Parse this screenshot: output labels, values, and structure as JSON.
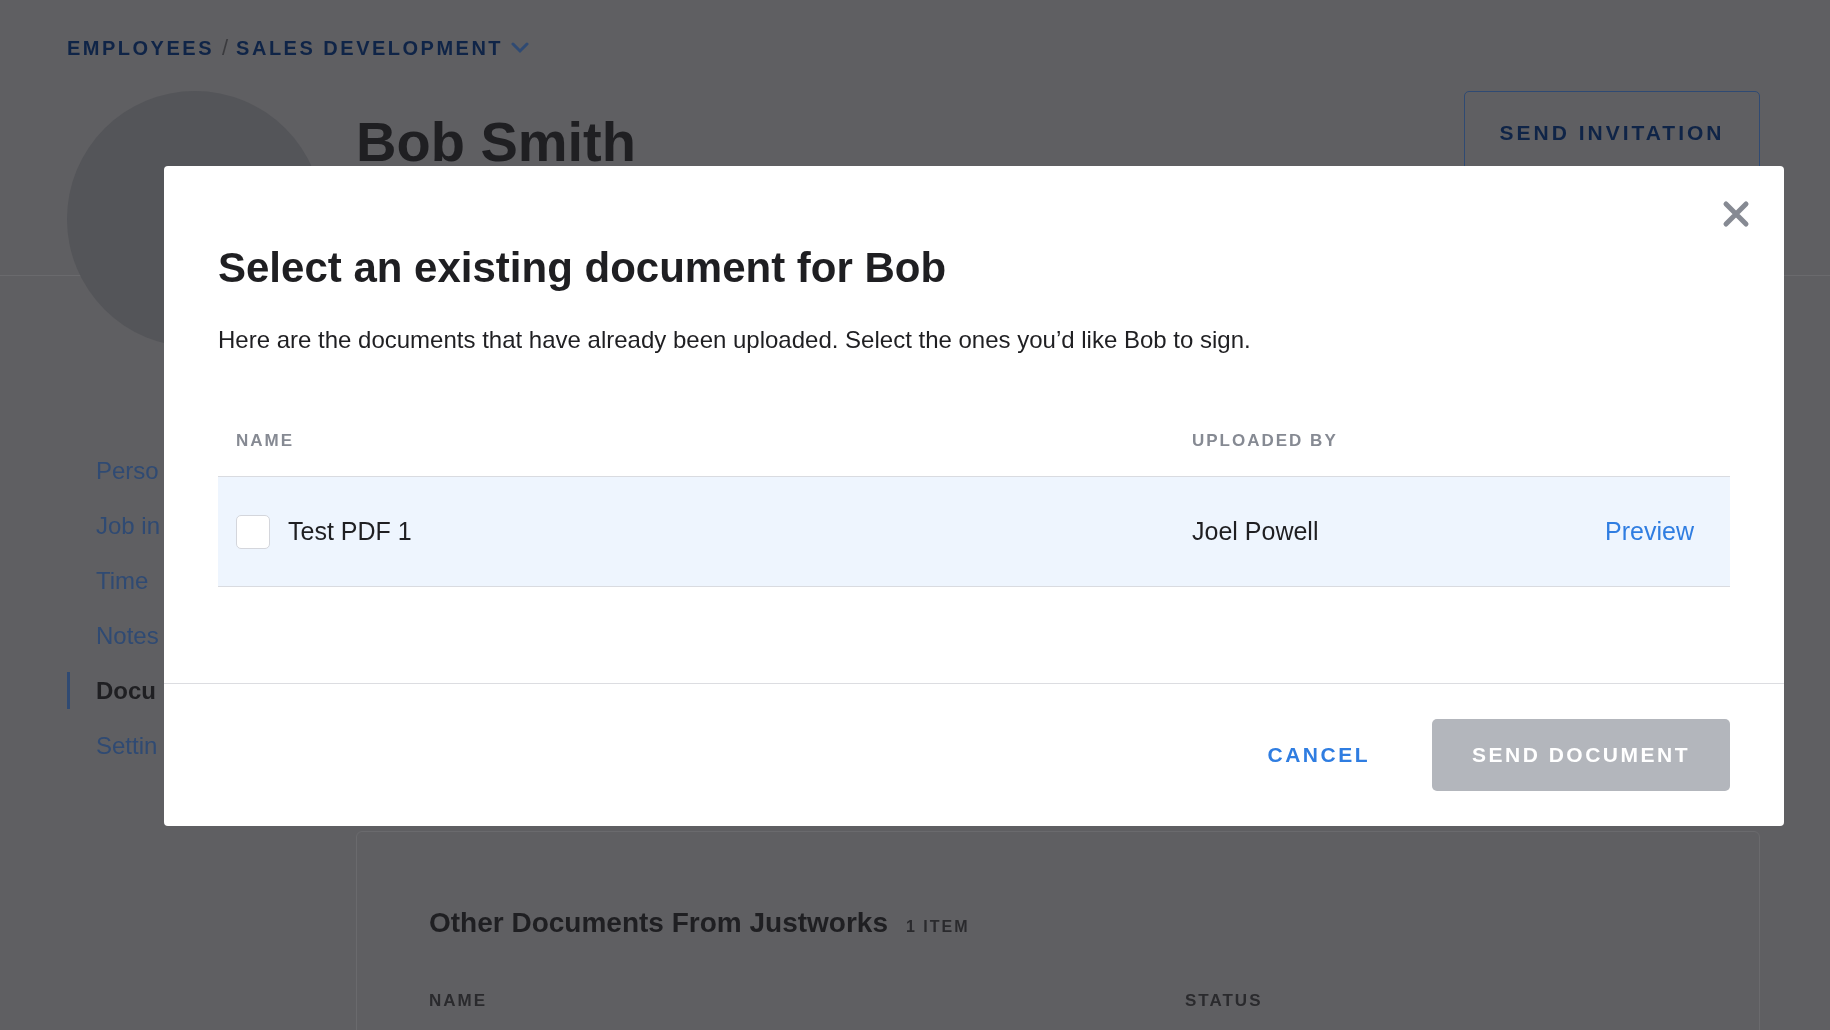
{
  "breadcrumb": {
    "items": [
      "EMPLOYEES",
      "SALES DEVELOPMENT"
    ],
    "separator": "/"
  },
  "profile": {
    "name": "Bob Smith",
    "action": "SEND INVITATION"
  },
  "sidebar": {
    "items": [
      {
        "label": "Perso",
        "selected": false
      },
      {
        "label": "Job in",
        "selected": false
      },
      {
        "label": "Time",
        "selected": false
      },
      {
        "label": "Notes",
        "selected": false
      },
      {
        "label": "Docu",
        "selected": true
      },
      {
        "label": "Settin",
        "selected": false
      }
    ]
  },
  "section": {
    "title": "Other Documents From Justworks",
    "count": "1 ITEM",
    "columns": [
      "NAME",
      "STATUS"
    ]
  },
  "modal": {
    "title": "Select an existing document for Bob",
    "description": "Here are the documents that have already been uploaded. Select the ones you’d like Bob to sign.",
    "columns": [
      "NAME",
      "UPLOADED BY"
    ],
    "rows": [
      {
        "name": "Test PDF 1",
        "uploaded_by": "Joel Powell",
        "action": "Preview",
        "checked": false
      }
    ],
    "cancel": "CANCEL",
    "submit": {
      "label": "SEND DOCUMENT",
      "disabled": true
    }
  }
}
